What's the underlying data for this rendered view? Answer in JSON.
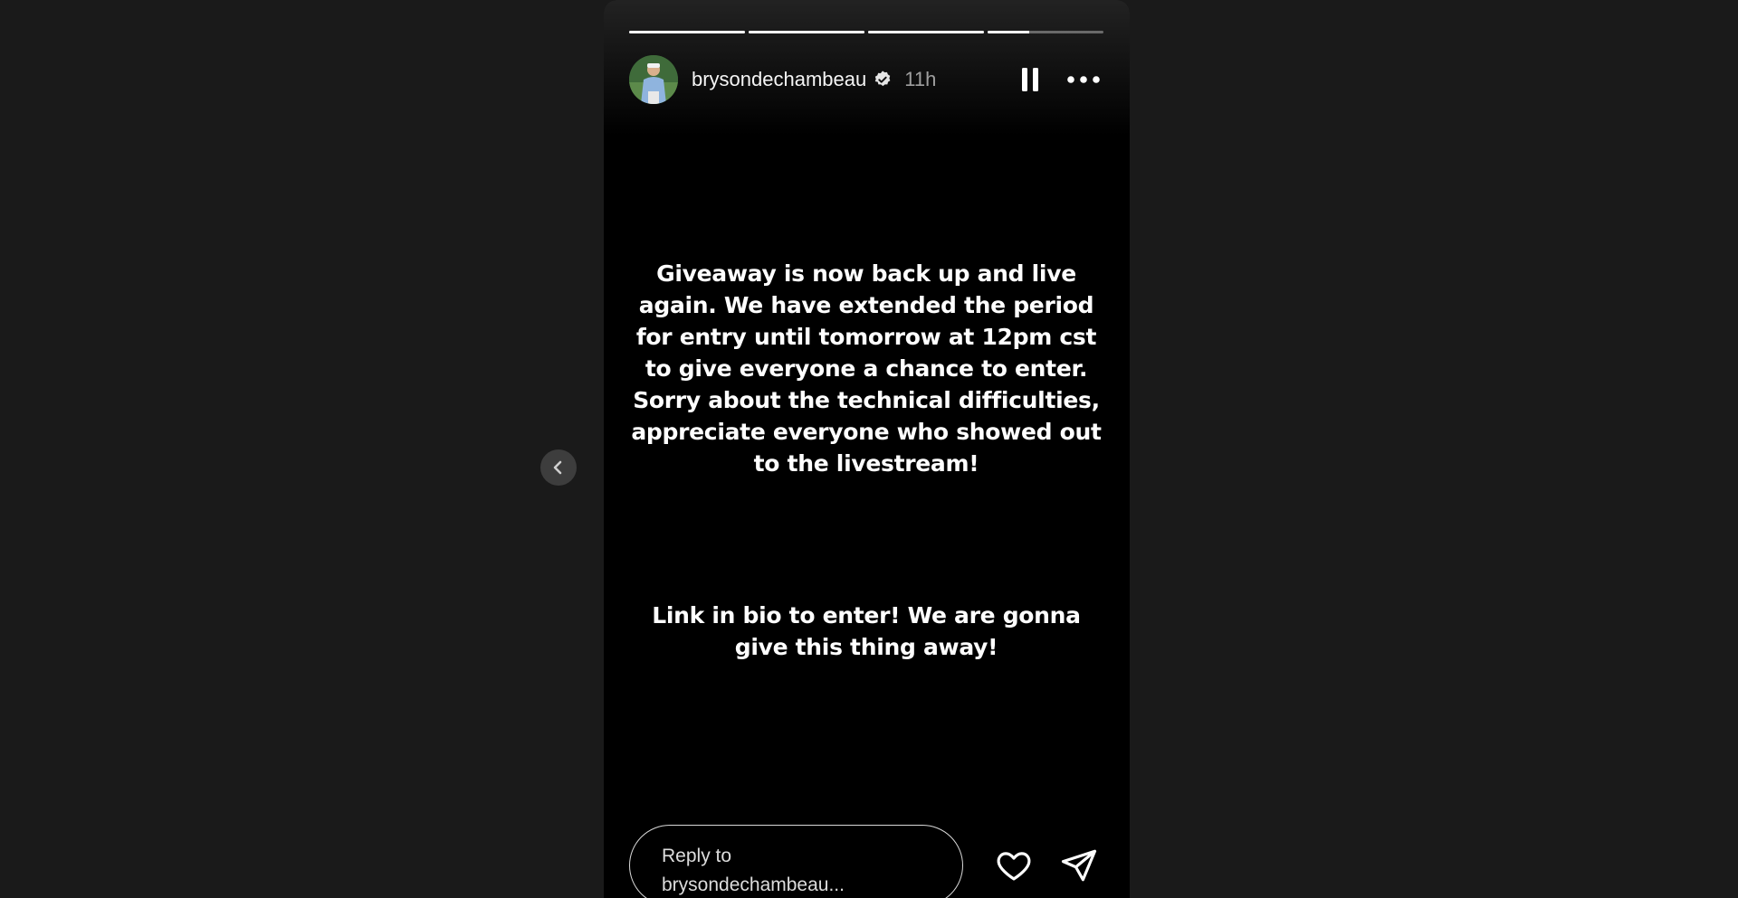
{
  "story": {
    "username": "brysondechambeau",
    "time_ago": "11h",
    "progress": [
      1,
      1,
      1,
      0.36
    ],
    "verified": true,
    "text_blocks": [
      "Giveaway is now back up and live again. We have extended the period for entry until tomorrow at 12pm cst to give everyone a chance to enter. Sorry about the technical difficulties, appreciate everyone who showed out to the livestream!",
      "Link in bio to enter! We are gonna give this thing away!"
    ]
  },
  "reply": {
    "placeholder": "Reply to\nbrysondechambeau..."
  },
  "icons": {
    "pause": "pause-icon",
    "more": "more-horizontal-icon",
    "like": "heart-icon",
    "share": "paper-plane-icon",
    "prev": "chevron-left-icon",
    "verified": "verified-badge-icon"
  },
  "colors": {
    "page_background": "#1a1a1a",
    "story_background": "#000000",
    "text": "#ffffff"
  }
}
